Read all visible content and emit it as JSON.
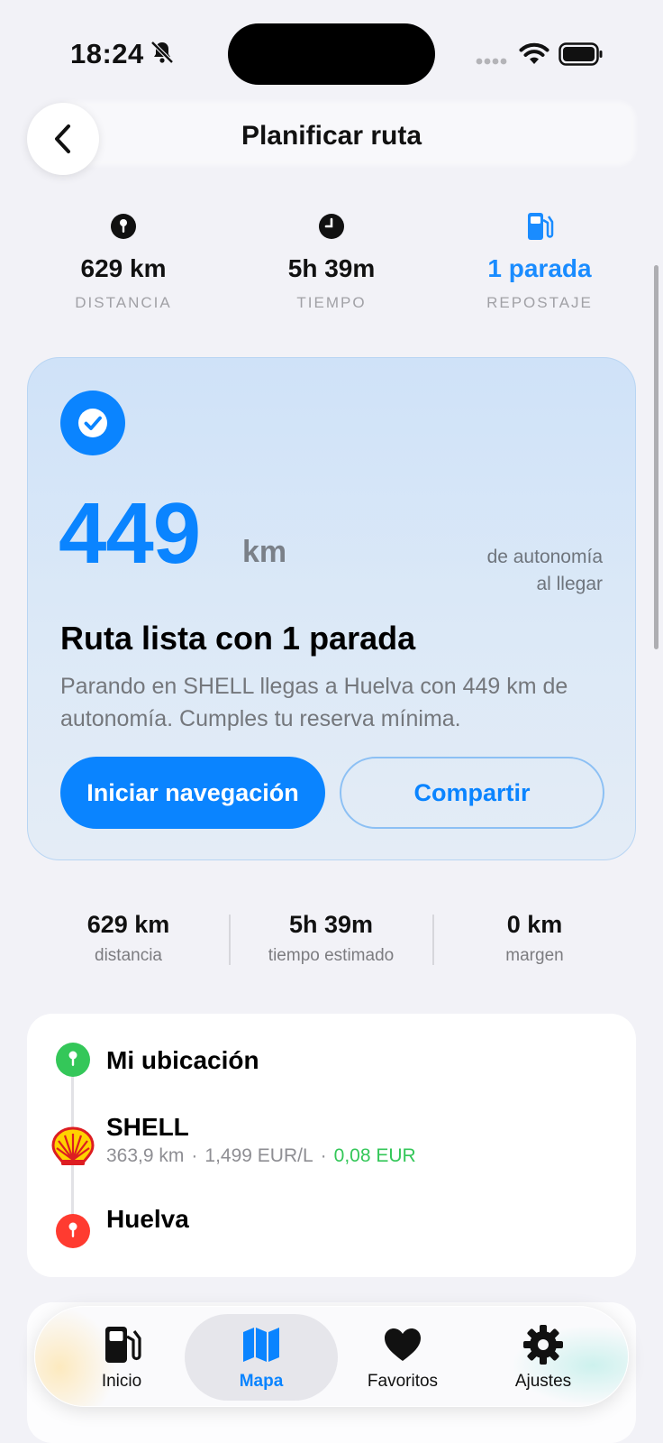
{
  "status_bar": {
    "time": "18:24"
  },
  "nav": {
    "title": "Planificar ruta"
  },
  "summary": [
    {
      "icon": "pin-icon",
      "value": "629 km",
      "label": "DISTANCIA"
    },
    {
      "icon": "clock-icon",
      "value": "5h 39m",
      "label": "TIEMPO"
    },
    {
      "icon": "fuel-pump-icon",
      "value": "1 parada",
      "label": "REPOSTAJE",
      "accent": "#1a8cff"
    }
  ],
  "hero": {
    "range_value": "449",
    "range_unit": "km",
    "range_note_line1": "de autonomía",
    "range_note_line2": "al llegar",
    "title": "Ruta lista con 1 parada",
    "description": "Parando en SHELL llegas a Huelva con 449 km de autonomía. Cumples tu reserva mínima.",
    "primary_button": "Iniciar navegación",
    "secondary_button": "Compartir"
  },
  "details": [
    {
      "value": "629 km",
      "label": "distancia"
    },
    {
      "value": "5h 39m",
      "label": "tiempo estimado"
    },
    {
      "value": "0 km",
      "label": "margen"
    }
  ],
  "route": {
    "origin": "Mi ubicación",
    "stop": {
      "name": "SHELL",
      "distance": "363,9 km",
      "price": "1,499 EUR/L",
      "saving": "0,08 EUR"
    },
    "destination": "Huelva"
  },
  "tabs": [
    {
      "icon": "fuel-pump-icon",
      "label": "Inicio",
      "active": false
    },
    {
      "icon": "map-icon",
      "label": "Mapa",
      "active": true
    },
    {
      "icon": "heart-icon",
      "label": "Favoritos",
      "active": false
    },
    {
      "icon": "gear-icon",
      "label": "Ajustes",
      "active": false
    }
  ],
  "colors": {
    "accent": "#0a84ff",
    "origin_pin": "#34c759",
    "destination_pin": "#ff3b30",
    "saving": "#34c759"
  }
}
